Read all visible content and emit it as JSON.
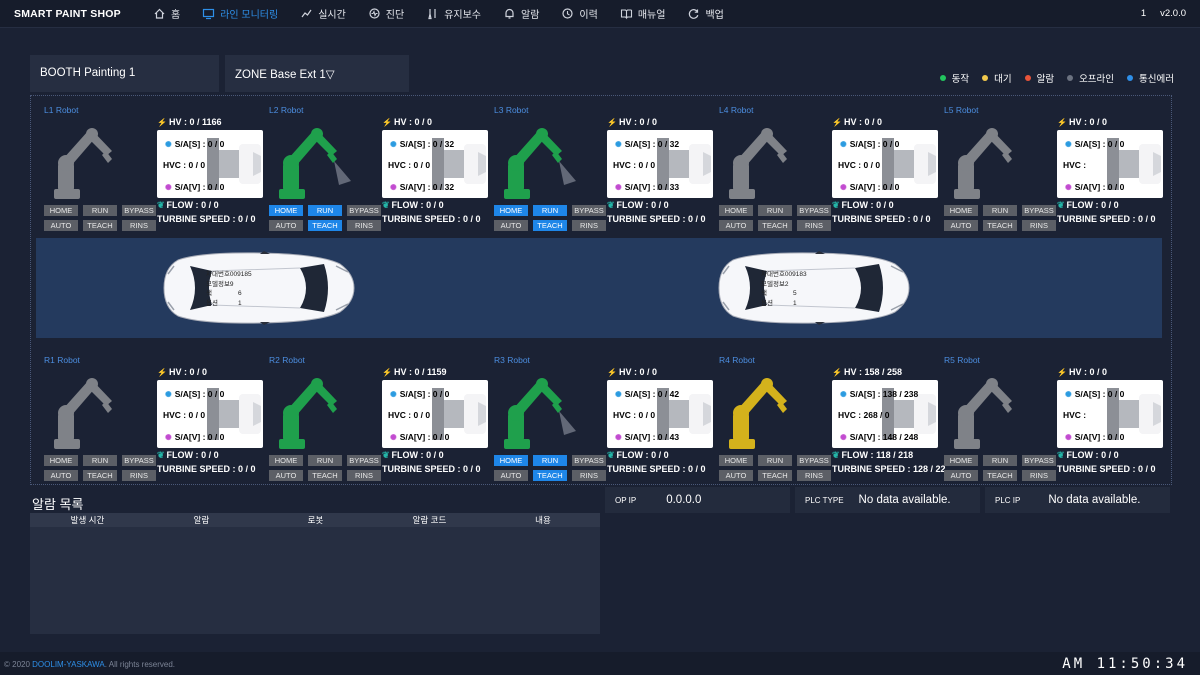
{
  "header": {
    "brand": "SMART PAINT SHOP",
    "version_num": "1",
    "version": "v2.0.0",
    "nav": [
      {
        "label": "홈",
        "icon": "home-icon"
      },
      {
        "label": "라인 모니터링",
        "icon": "monitor-icon",
        "active": true
      },
      {
        "label": "실시간",
        "icon": "realtime-icon"
      },
      {
        "label": "진단",
        "icon": "diagnosis-icon"
      },
      {
        "label": "유지보수",
        "icon": "maintenance-icon"
      },
      {
        "label": "알람",
        "icon": "bell-icon"
      },
      {
        "label": "이력",
        "icon": "history-icon"
      },
      {
        "label": "매뉴얼",
        "icon": "book-icon"
      },
      {
        "label": "백업",
        "icon": "backup-icon"
      }
    ]
  },
  "booth": {
    "name": "BOOTH Painting 1",
    "zone": "ZONE Base Ext 1▽"
  },
  "legend": [
    {
      "label": "동작",
      "color": "#22c55e"
    },
    {
      "label": "대기",
      "color": "#f2c94c"
    },
    {
      "label": "알람",
      "color": "#e8543a"
    },
    {
      "label": "오프라인",
      "color": "#6b7280"
    },
    {
      "label": "통신에러",
      "color": "#2e8fe8"
    }
  ],
  "buttons": {
    "home": "HOME",
    "run": "RUN",
    "bypass": "BYPASS",
    "auto": "AUTO",
    "teach": "TEACH",
    "rins": "RINS"
  },
  "labels": {
    "sa_s": "S/A[S] :",
    "sa_v": "S/A[V] :",
    "hvc": "HVC :",
    "hv": "HV :",
    "flow": "FLOW :",
    "turbine": "TURBINE SPEED :"
  },
  "robots": [
    {
      "name": "L1 Robot",
      "color": "#7f8288",
      "hv": "0 / 1166",
      "sas": "0 / 0",
      "hvc": "0 / 0",
      "sav": "0 / 0",
      "flow": "0 / 0",
      "turbine": "0 / 0",
      "active": [],
      "spray": false
    },
    {
      "name": "L2 Robot",
      "color": "#1fa04c",
      "hv": "0 / 0",
      "sas": "0 / 32",
      "hvc": "0 / 0",
      "sav": "0 / 32",
      "flow": "0 / 0",
      "turbine": "0 / 0",
      "active": [
        "home",
        "run",
        "teach"
      ],
      "spray": true
    },
    {
      "name": "L3 Robot",
      "color": "#1fa04c",
      "hv": "0 / 0",
      "sas": "0 / 32",
      "hvc": "0 / 0",
      "sav": "0 / 33",
      "flow": "0 / 0",
      "turbine": "0 / 0",
      "active": [
        "home",
        "run",
        "teach"
      ],
      "spray": true
    },
    {
      "name": "L4 Robot",
      "color": "#7f8288",
      "hv": "0 / 0",
      "sas": "0 / 0",
      "hvc": "0 / 0",
      "sav": "0 / 0",
      "flow": "0 / 0",
      "turbine": "0 / 0",
      "active": [],
      "spray": false
    },
    {
      "name": "L5 Robot",
      "color": "#7f8288",
      "hv": "0 / 0",
      "sas": "0 / 0",
      "hvc": "",
      "sav": "0 / 0",
      "flow": "0 / 0",
      "turbine": "0 / 0",
      "active": [],
      "spray": false
    },
    {
      "name": "R1 Robot",
      "color": "#7f8288",
      "hv": "0 / 0",
      "sas": "0 / 0",
      "hvc": "0 / 0",
      "sav": "0 / 0",
      "flow": "0 / 0",
      "turbine": "0 / 0",
      "active": [],
      "spray": false
    },
    {
      "name": "R2 Robot",
      "color": "#1fa04c",
      "hv": "0 / 1159",
      "sas": "0 / 0",
      "hvc": "0 / 0",
      "sav": "0 / 0",
      "flow": "0 / 0",
      "turbine": "0 / 0",
      "active": [],
      "spray": false
    },
    {
      "name": "R3 Robot",
      "color": "#1fa04c",
      "hv": "0 / 0",
      "sas": "0 / 42",
      "hvc": "0 / 0",
      "sav": "0 / 43",
      "flow": "0 / 0",
      "turbine": "0 / 0",
      "active": [
        "home",
        "run",
        "teach"
      ],
      "spray": true
    },
    {
      "name": "R4 Robot",
      "color": "#d4b21c",
      "hv": "158 / 258",
      "sas": "138 / 238",
      "hvc": "268 / 0",
      "sav": "148 / 248",
      "flow": "118 / 218",
      "turbine": "128 / 22",
      "active": [],
      "spray": false
    },
    {
      "name": "R5 Robot",
      "color": "#7f8288",
      "hv": "0 / 0",
      "sas": "0 / 0",
      "hvc": "",
      "sav": "0 / 0",
      "flow": "0 / 0",
      "turbine": "0 / 0",
      "active": [],
      "spray": false
    }
  ],
  "cars": [
    {
      "body": "차대번호009185",
      "model": "모델정보9",
      "color_label": "색",
      "color_val": "6",
      "option_label": "옵션",
      "option_val": "1"
    },
    {
      "body": "차대번호009183",
      "model": "모델정보2",
      "color_label": "색",
      "color_val": "5",
      "option_label": "옵션",
      "option_val": "1"
    }
  ],
  "alarm": {
    "title": "알람 목록",
    "columns": [
      "발생 시간",
      "알람",
      "로봇",
      "알람 코드",
      "내용"
    ]
  },
  "info": {
    "op_ip_label": "OP IP",
    "op_ip": "0.0.0.0",
    "plc_type_label": "PLC TYPE",
    "plc_type": "No data available.",
    "plc_ip_label": "PLC IP",
    "plc_ip": "No data available."
  },
  "footer": {
    "copy_pre": "© 2020",
    "copy_brand": "DOOLIM-YASKAWA",
    "copy_post": ". All rights reserved.",
    "clock": "AM 11:50:34"
  }
}
